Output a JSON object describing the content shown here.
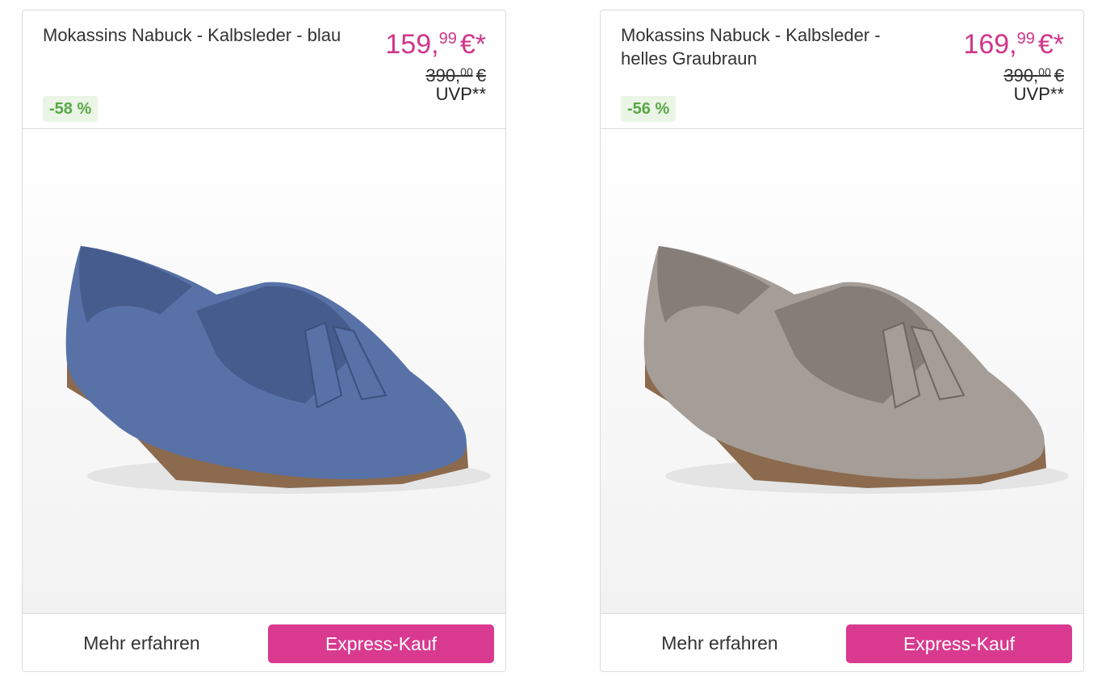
{
  "products": [
    {
      "title": "Mokassins Nabuck - Kalbsleder - blau",
      "price_main": "159,",
      "price_cents": "99",
      "price_suffix": "€*",
      "old_price_main": "390,",
      "old_price_cents": "00",
      "old_price_suffix": "€",
      "uvp": "UVP**",
      "discount": "-58 %",
      "more_label": "Mehr erfahren",
      "express_label": "Express-Kauf",
      "shoe_color": "#5872a8",
      "shoe_shadow": "#455c8c"
    },
    {
      "title": "Mokassins Nabuck - Kalbsleder - helles Graubraun",
      "price_main": "169,",
      "price_cents": "99",
      "price_suffix": "€*",
      "old_price_main": "390,",
      "old_price_cents": "00",
      "old_price_suffix": "€",
      "uvp": "UVP**",
      "discount": "-56 %",
      "more_label": "Mehr erfahren",
      "express_label": "Express-Kauf",
      "shoe_color": "#a59d97",
      "shoe_shadow": "#857d78"
    }
  ],
  "colors": {
    "accent": "#d93a8f",
    "price": "#d0368a",
    "discount_text": "#58a846",
    "discount_bg": "#eaf5e6"
  }
}
